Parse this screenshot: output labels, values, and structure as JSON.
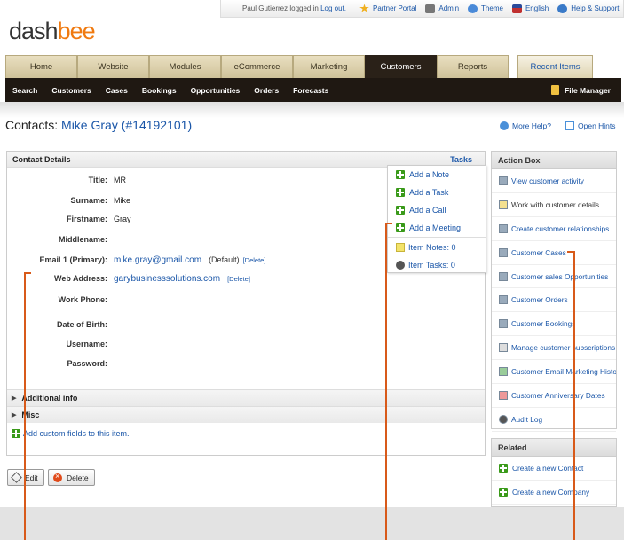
{
  "topbar": {
    "logged_in": "Paul Gutierrez logged in",
    "logout": "Log out.",
    "partner": "Partner Portal",
    "admin": "Admin",
    "theme": "Theme",
    "language": "English",
    "help": "Help & Support"
  },
  "logo": {
    "part1": "dash",
    "part2": "bee"
  },
  "tabs": [
    "Home",
    "Website",
    "Modules",
    "eCommerce",
    "Marketing",
    "Customers",
    "Reports"
  ],
  "recent_items": "Recent Items",
  "subnav": [
    "Search",
    "Customers",
    "Cases",
    "Bookings",
    "Opportunities",
    "Orders",
    "Forecasts"
  ],
  "file_manager": "File Manager",
  "page": {
    "prefix": "Contacts:",
    "name": "Mike Gray (#14192101)",
    "more_help": "More Help?",
    "open_hints": "Open Hints"
  },
  "contact": {
    "header": "Contact Details",
    "tasks_link": "Tasks",
    "fields": {
      "title_label": "Title:",
      "title_value": "MR",
      "surname_label": "Surname:",
      "surname_value": "Mike",
      "firstname_label": "Firstname:",
      "firstname_value": "Gray",
      "middlename_label": "Middlename:",
      "email_label": "Email 1 (Primary):",
      "email_value": "mike.gray@gmail.com",
      "email_default": "(Default)",
      "email_delete": "[Delete]",
      "web_label": "Web Address:",
      "web_value": "garybusinesssolutions.com",
      "web_delete": "[Delete]",
      "workphone_label": "Work Phone:",
      "dob_label": "Date of Birth:",
      "username_label": "Username:",
      "password_label": "Password:"
    },
    "additional_info": "Additional info",
    "misc": "Misc",
    "add_custom": "Add custom fields to this item."
  },
  "tasks_menu": [
    "Add a Note",
    "Add a Task",
    "Add a Call",
    "Add a Meeting"
  ],
  "item_notes": "Item Notes: 0",
  "item_tasks": "Item Tasks: 0",
  "buttons": {
    "edit": "Edit",
    "delete": "Delete"
  },
  "action_box": {
    "title": "Action Box",
    "items": [
      "View customer activity",
      "Work with customer details",
      "Create customer relationships",
      "Customer Cases",
      "Customer sales Opportunities",
      "Customer Orders",
      "Customer Bookings",
      "Manage customer subscriptions",
      "Customer Email Marketing History",
      "Customer Anniversary Dates",
      "Audit Log"
    ]
  },
  "related": {
    "title": "Related",
    "items": [
      "Create a new Contact",
      "Create a new Company"
    ]
  }
}
